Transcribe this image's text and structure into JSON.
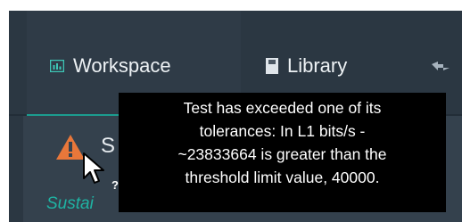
{
  "tabs": {
    "workspace": {
      "label": "Workspace",
      "icon": "chart-icon"
    },
    "library": {
      "label": "Library",
      "icon": "book-icon"
    },
    "more": {
      "icon": "link-icon"
    }
  },
  "test_item": {
    "status_icon": "warning-icon",
    "status_label": "Sustai",
    "title_fragment": "S"
  },
  "tooltip": {
    "lines": [
      "Test has exceeded one of its",
      "tolerances: In L1 bits/s -",
      "~23833664 is greater than the",
      "threshold limit value, 40000."
    ]
  },
  "cursor": {
    "help_mark": "?"
  },
  "colors": {
    "app_background": "#2b3742",
    "panel_background": "#34414d",
    "accent": "#1c9c8f",
    "warning": "#e8773a",
    "tooltip_background": "#000000"
  }
}
